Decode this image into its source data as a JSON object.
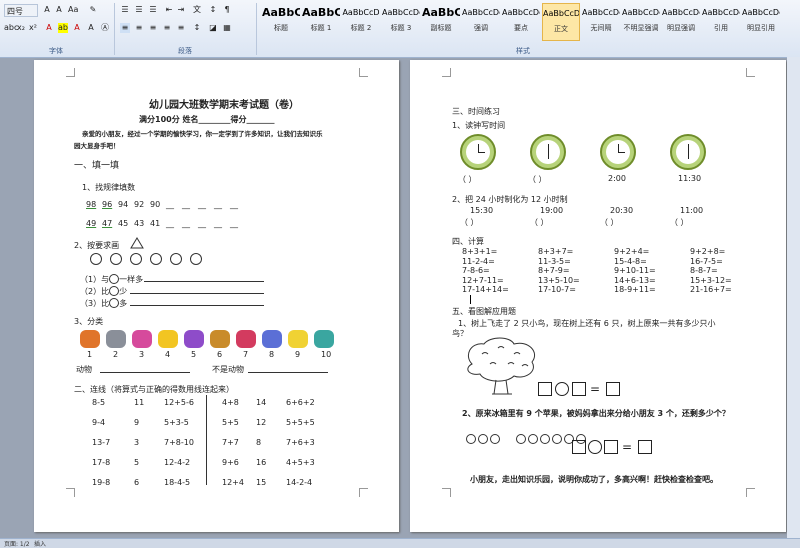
{
  "ribbon": {
    "font_size": "四号",
    "font_group_label": "字体",
    "para_group_label": "段落",
    "styles_group_label": "样式",
    "styles": [
      {
        "sample": "AaBbC",
        "name": "标题"
      },
      {
        "sample": "AaBbC",
        "name": "标题 1"
      },
      {
        "sample": "AaBbCcD",
        "name": "标题 2"
      },
      {
        "sample": "AaBbCcDd",
        "name": "标题 3"
      },
      {
        "sample": "AaBbC",
        "name": "副标题"
      },
      {
        "sample": "AaBbCcDd",
        "name": "强调"
      },
      {
        "sample": "AaBbCcDd",
        "name": "要点"
      },
      {
        "sample": "AaBbCcDc",
        "name": "正文"
      },
      {
        "sample": "AaBbCcDc",
        "name": "无间隔"
      },
      {
        "sample": "AaBbCcDc",
        "name": "不明显强调"
      },
      {
        "sample": "AaBbCcDc",
        "name": "明显强调"
      },
      {
        "sample": "AaBbCcDc",
        "name": "引用"
      },
      {
        "sample": "AaBbCcDc",
        "name": "明显引用"
      }
    ]
  },
  "page1": {
    "title": "幼儿园大班数学期末考试题（卷）",
    "score_line": "满分100分      姓名________得分_______",
    "intro1": "亲爱的小朋友，经过一个学期的愉快学习，你一定学到了许多知识，让我们去知识乐",
    "intro2": "园大显身手吧！",
    "s1": "一、填一填",
    "s1_1": "1、找规律填数",
    "row1": [
      "98",
      "96",
      "94",
      "92",
      "90",
      "__",
      "__",
      "__",
      "__",
      "__"
    ],
    "row2": [
      "49",
      "47",
      "45",
      "43",
      "41",
      "__",
      "__",
      "__",
      "__",
      "__"
    ],
    "s1_2": "2、按要求画",
    "q1": "（1）与",
    "q1b": "一样多",
    "q2": "（2）比",
    "q2b": "少",
    "q3": "（3）比",
    "q3b": "多",
    "s1_3": "3、分类",
    "animals_nums": [
      "1",
      "2",
      "3",
      "4",
      "5",
      "6",
      "7",
      "8",
      "9",
      "10"
    ],
    "animal": "动物",
    "not_animal": "不是动物",
    "s2": "二、连线（将算式与正确的得数用线连起来）",
    "left_cols": [
      [
        "8-5",
        "11",
        "12+5-6"
      ],
      [
        "9-4",
        "9",
        "5+3-5"
      ],
      [
        "13-7",
        "3",
        "7+8-10"
      ],
      [
        "17-8",
        "5",
        "12-4-2"
      ],
      [
        "19-8",
        "6",
        "18-4-5"
      ]
    ],
    "right_cols": [
      [
        "4+8",
        "14",
        "6+6+2"
      ],
      [
        "5+5",
        "12",
        "5+5+5"
      ],
      [
        "7+7",
        "8",
        "7+6+3"
      ],
      [
        "9+6",
        "16",
        "4+5+3"
      ],
      [
        "12+4",
        "15",
        "14-2-4"
      ]
    ]
  },
  "page2": {
    "s3": "三、时间练习",
    "s3_1": "1、读钟写时间",
    "paren": "（          ）",
    "clock_times": [
      "2:00",
      "11:30"
    ],
    "s3_2": "2、把 24 小时制化为 12 小时制",
    "h24": [
      "15:30",
      "19:00",
      "20:30",
      "11:00"
    ],
    "s4": "四、计算",
    "calc": [
      [
        "8+3+1=",
        "8+3+7=",
        "9+2+4=",
        "9+2+8="
      ],
      [
        "11-2-4=",
        "11-3-5=",
        "15-4-8=",
        "16-7-5="
      ],
      [
        "7-8-6=",
        "8+7-9=",
        "9+10-11=",
        "8-8-7="
      ],
      [
        "12+7-11=",
        "13+5-10=",
        "14+6-13=",
        "15+3-12="
      ],
      [
        "17-14+14=",
        "17-10-7=",
        "18-9+11=",
        "21-16+7="
      ]
    ],
    "s5": "五、看图解应用题",
    "p1a": "1、树上飞走了 2 只小鸟，现在树上还有 6 只，树上原来一共有多少只小",
    "p1b": "鸟？",
    "p2": "2、原来冰箱里有 9 个苹果，被妈妈拿出来分给小朋友 3 个，还剩多少个？",
    "closing": "小朋友，走出知识乐园，说明你成功了，多高兴啊！赶快检查检查吧。"
  },
  "status": {
    "left": "页面: 1/2",
    "mode": "插入"
  }
}
